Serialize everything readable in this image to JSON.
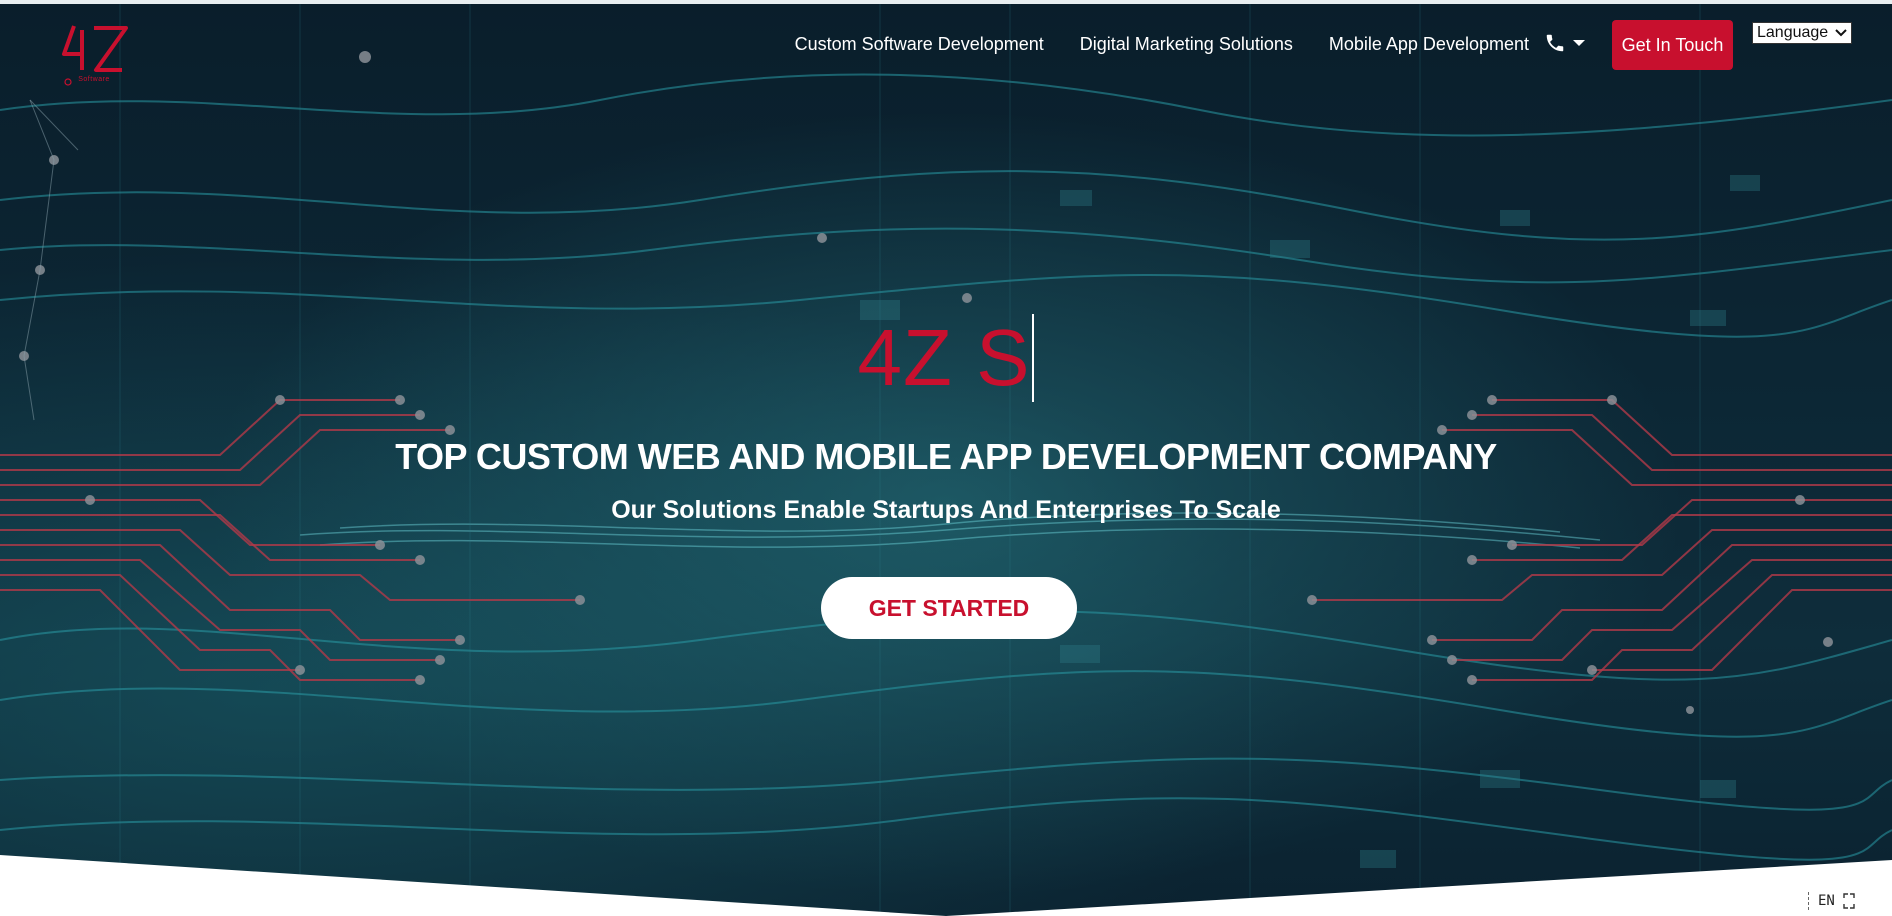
{
  "brand": {
    "logo_alt": "4Z Software logo",
    "logo_sub": "Software"
  },
  "nav": {
    "items": [
      {
        "label": "Custom Software Development"
      },
      {
        "label": "Digital Marketing Solutions"
      },
      {
        "label": "Mobile App Development"
      }
    ],
    "phone_icon": "phone-icon",
    "get_in_touch": "Get In Touch",
    "language_label": "Language"
  },
  "hero": {
    "typed_text": "4Z S",
    "headline": "TOP CUSTOM WEB AND MOBILE APP DEVELOPMENT COMPANY",
    "subline": "Our Solutions Enable Startups And Enterprises To Scale",
    "cta_label": "GET STARTED"
  },
  "widget": {
    "lang_code": "EN"
  },
  "colors": {
    "accent": "#c8102e",
    "hero_bg": "#0c2634",
    "text_light": "#ffffff"
  }
}
